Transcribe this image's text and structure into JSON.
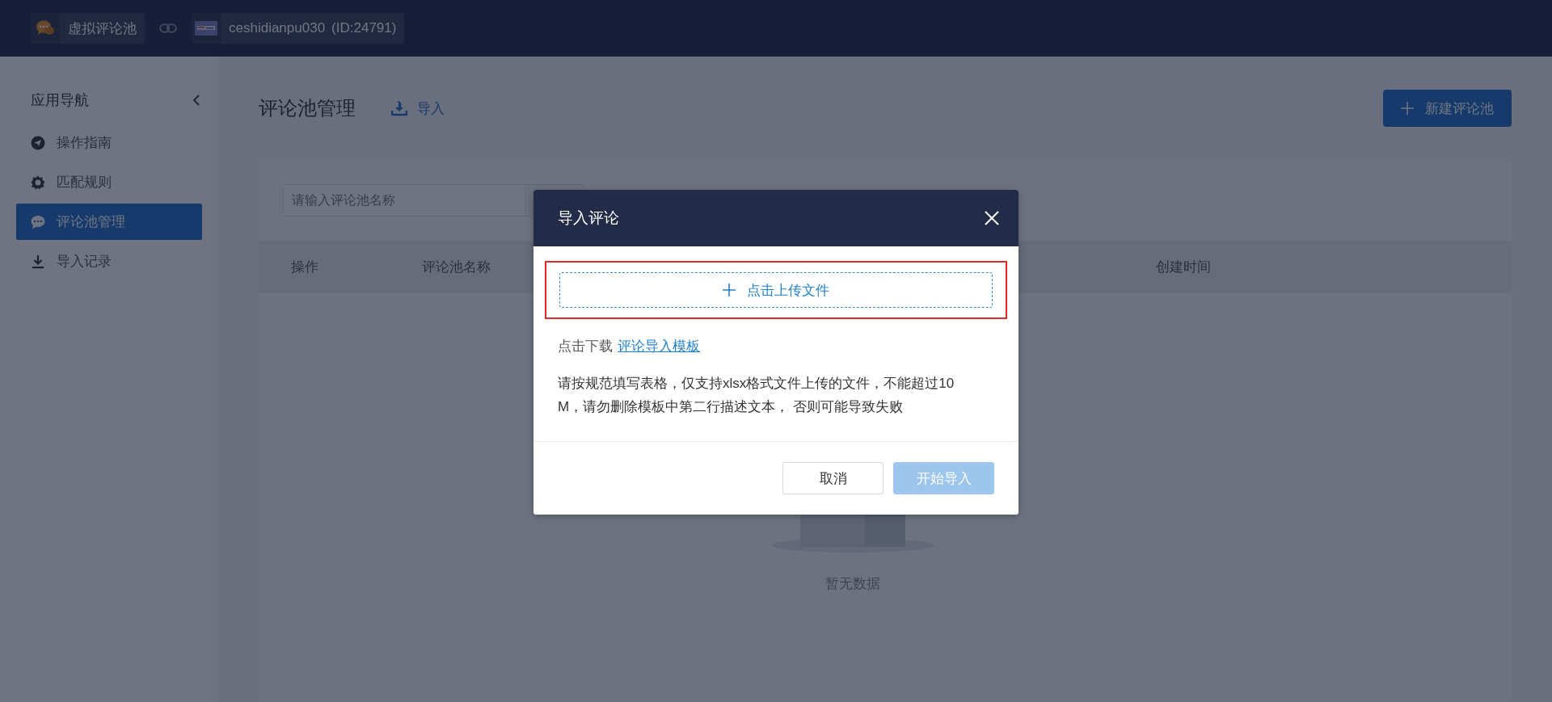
{
  "top_bar": {
    "app": {
      "name": "虚拟评论池"
    },
    "store": {
      "name": "ceshidianpu030",
      "id": "(ID:24791)"
    }
  },
  "sidebar": {
    "title": "应用导航",
    "items": [
      {
        "label": "操作指南",
        "selected": false
      },
      {
        "label": "匹配规则",
        "selected": false
      },
      {
        "label": "评论池管理",
        "selected": true
      },
      {
        "label": "导入记录",
        "selected": false
      }
    ]
  },
  "page": {
    "title": "评论池管理",
    "import_link": "导入",
    "new_button": "新建评论池",
    "search": {
      "placeholder": "请输入评论池名称"
    },
    "table": {
      "columns": [
        "操作",
        "评论池名称",
        "创建时间"
      ],
      "empty_text": "暂无数据"
    }
  },
  "modal": {
    "title": "导入评论",
    "upload": {
      "label": "点击上传文件",
      "highlighted": true
    },
    "download_prefix": "点击下载",
    "download_link": "评论导入模板",
    "description": "请按规范填写表格，仅支持xlsx格式文件上传的文件，不能超过10M，请勿删除模板中第二行描述文本， 否则可能导致失败",
    "buttons": [
      {
        "label": "取消",
        "kind": "secondary",
        "disabled": false
      },
      {
        "label": "开始导入",
        "kind": "primary",
        "disabled": true
      }
    ]
  }
}
